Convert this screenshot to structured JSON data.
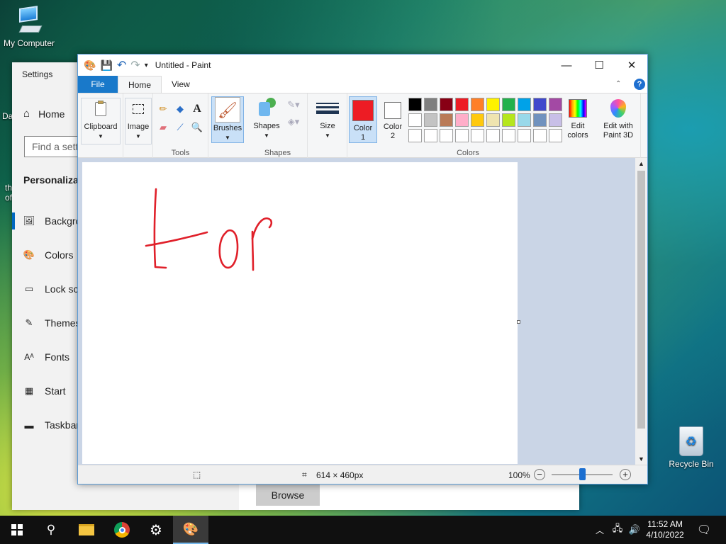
{
  "desktop": {
    "icons": [
      {
        "label": "My Computer",
        "icon": "computer-icon"
      },
      {
        "label": "Recycle Bin",
        "icon": "recycle-bin-icon"
      }
    ],
    "partial_texts": [
      "Da",
      "th",
      "of"
    ]
  },
  "settings": {
    "title": "Settings",
    "home_label": "Home",
    "search_placeholder": "Find a sett",
    "section_title": "Personalizat",
    "items": [
      {
        "label": "Backgro",
        "icon": "picture-icon"
      },
      {
        "label": "Colors",
        "icon": "palette-icon"
      },
      {
        "label": "Lock sc",
        "icon": "lock-screen-icon"
      },
      {
        "label": "Themes",
        "icon": "themes-icon"
      },
      {
        "label": "Fonts",
        "icon": "fonts-icon"
      },
      {
        "label": "Start",
        "icon": "start-icon"
      },
      {
        "label": "Taskbar",
        "icon": "taskbar-icon"
      }
    ],
    "browse_label": "Browse"
  },
  "paint": {
    "window_title": "Untitled - Paint",
    "tabs": [
      "File",
      "Home",
      "View"
    ],
    "groups": {
      "clipboard": "Clipboard",
      "image": "Image",
      "tools": "Tools",
      "brushes": "Brushes",
      "shapes_btn": "Shapes",
      "shapes_group": "Shapes",
      "size": "Size",
      "color1": "Color",
      "color1_num": "1",
      "color2": "Color",
      "color2_num": "2",
      "colors_group": "Colors",
      "edit_colors_1": "Edit",
      "edit_colors_2": "colors",
      "paint3d_1": "Edit with",
      "paint3d_2": "Paint 3D"
    },
    "color1_value": "#ed1c24",
    "color2_value": "#ffffff",
    "palette_row1": [
      "#000000",
      "#7f7f7f",
      "#880015",
      "#ed1c24",
      "#ff7f27",
      "#fff200",
      "#22b14c",
      "#00a2e8",
      "#3f48cc",
      "#a349a4"
    ],
    "palette_row2": [
      "#ffffff",
      "#c3c3c3",
      "#b97a57",
      "#ffaec9",
      "#ffc90e",
      "#efe4b0",
      "#b5e61d",
      "#99d9ea",
      "#7092be",
      "#c8bfe7"
    ],
    "palette_row3": [
      "#ffffff",
      "#ffffff",
      "#ffffff",
      "#ffffff",
      "#ffffff",
      "#ffffff",
      "#ffffff",
      "#ffffff",
      "#ffffff",
      "#ffffff"
    ],
    "canvas_size": "614 × 460px",
    "zoom": "100%",
    "zoom_level": 0.5,
    "drawing_color": "#e0202a"
  },
  "taskbar": {
    "time": "11:52 AM",
    "date": "4/10/2022"
  }
}
